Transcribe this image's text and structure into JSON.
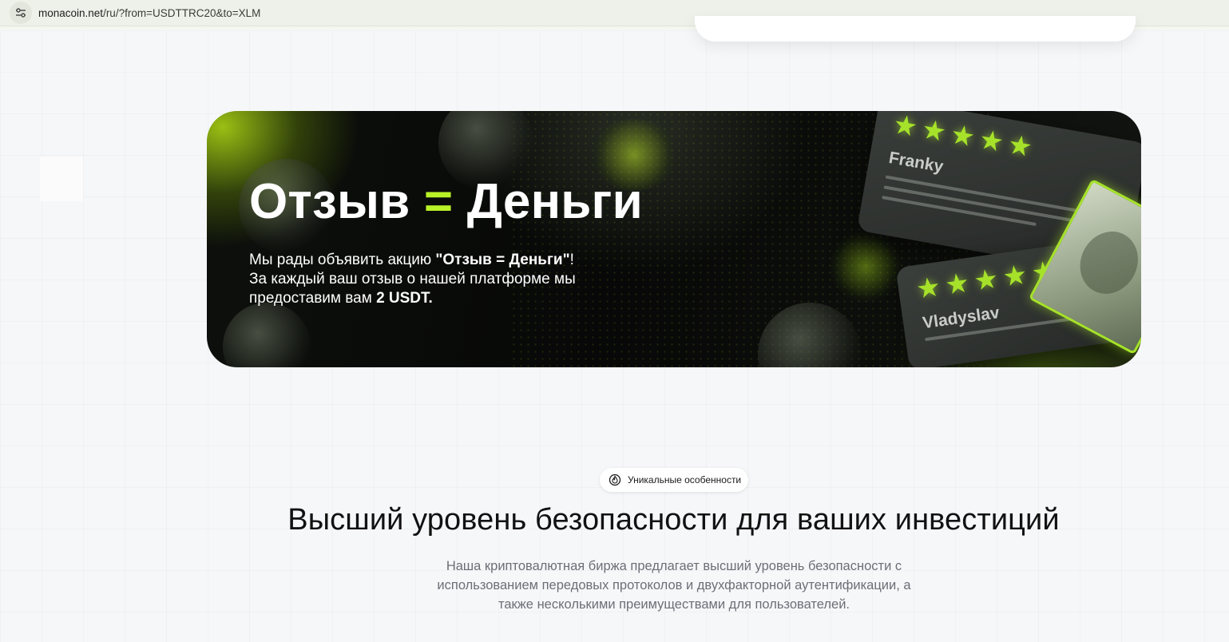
{
  "browser": {
    "url_host": "monacoin.net",
    "url_path": "/ru/?from=USDTTRC20&to=XLM"
  },
  "banner": {
    "title_left": "Отзыв",
    "title_eq": "=",
    "title_right": "Деньги",
    "text_line1_prefix": "Мы рады объявить акцию ",
    "text_line1_bold": "\"Отзыв = Деньги\"",
    "text_line1_suffix": "!",
    "text_line2": "За каждый ваш отзыв о нашей платформе мы",
    "text_line3_prefix": "предоставим вам ",
    "text_line3_bold": "2 USDT.",
    "reviews": [
      {
        "name": "Franky",
        "stars": 5
      },
      {
        "name": "Vladyslav",
        "stars": 5
      }
    ],
    "accent_color": "#b9f227"
  },
  "features": {
    "badge_label": "Уникальные особенности",
    "title": "Высший уровень безопасности для ваших инвестиций",
    "description": "Наша криптовалютная биржа предлагает высший уровень безопасности с использованием передовых протоколов и двухфакторной аутентификации, а также несколькими преимуществами для пользователей."
  }
}
